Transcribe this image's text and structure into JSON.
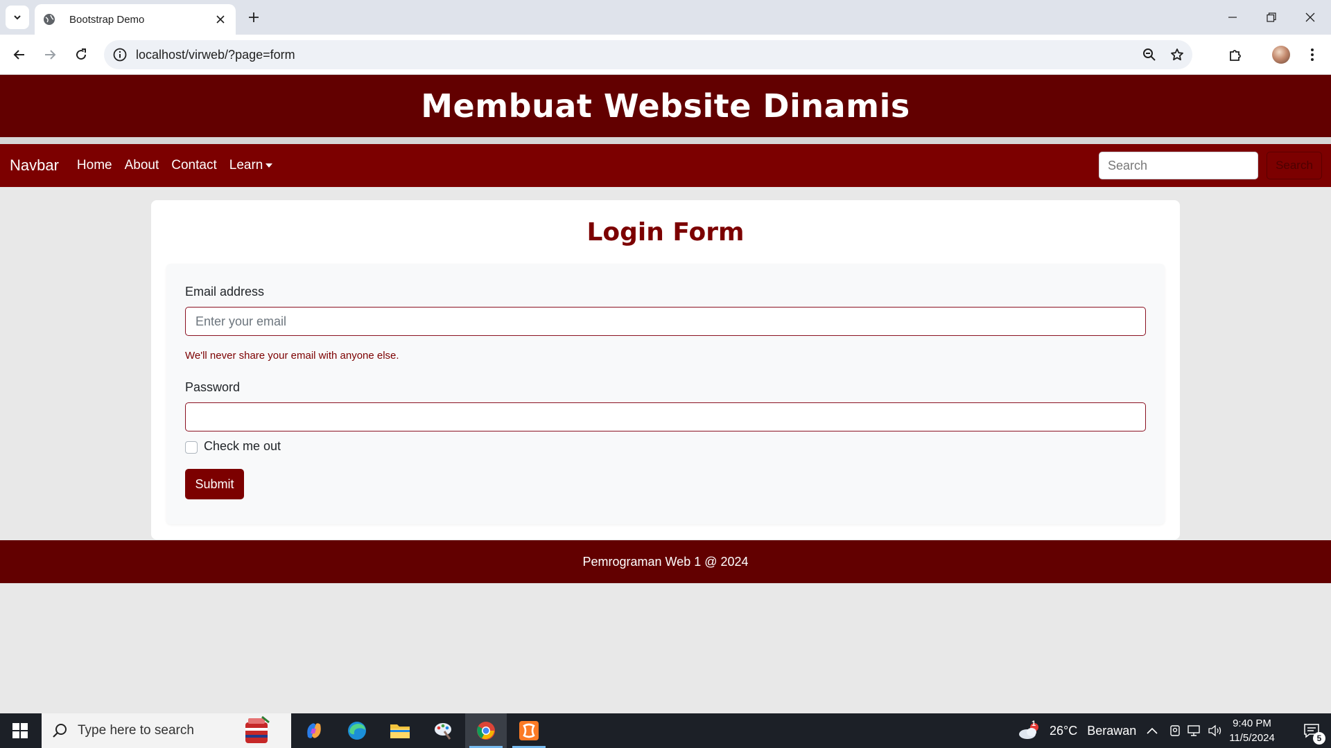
{
  "browser": {
    "tab_title": "Bootstrap Demo",
    "url": "localhost/virweb/?page=form"
  },
  "site": {
    "header_title": "Membuat Website Dinamis",
    "nav": {
      "brand": "Navbar",
      "links": [
        "Home",
        "About",
        "Contact",
        "Learn"
      ],
      "search_placeholder": "Search",
      "search_button": "Search"
    },
    "form": {
      "title": "Login Form",
      "email_label": "Email address",
      "email_placeholder": "Enter your email",
      "email_help": "We'll never share your email with anyone else.",
      "password_label": "Password",
      "password_value": "",
      "checkbox_label": "Check me out",
      "checkbox_checked": false,
      "submit_label": "Submit"
    },
    "footer": "Pemrograman Web 1 @ 2024"
  },
  "taskbar": {
    "search_placeholder": "Type here to search",
    "weather_temp": "26°C",
    "weather_text": "Berawan",
    "weather_badge": "1",
    "time": "9:40 PM",
    "date": "11/5/2024",
    "notification_count": "5",
    "apps": [
      "copilot-icon",
      "edge-icon",
      "file-explorer-icon",
      "paint-icon",
      "chrome-icon",
      "xampp-icon"
    ]
  },
  "colors": {
    "header_bg": "#620000",
    "navbar_bg": "#7c0000",
    "accent": "#7c0000"
  }
}
